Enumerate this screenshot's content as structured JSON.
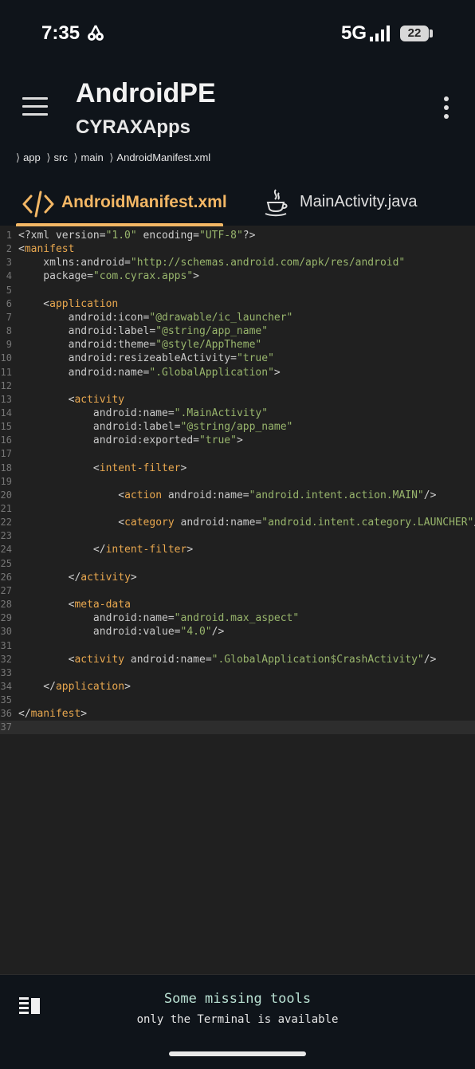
{
  "status_bar": {
    "time": "7:35",
    "network": "5G",
    "battery": "22",
    "icons": [
      "cherry-icon",
      "signal-icon",
      "battery-icon"
    ]
  },
  "toolbar": {
    "title": "AndroidPE",
    "subtitle": "CYRAXApps",
    "menu_icon": "hamburger-menu-icon",
    "more_icon": "more-vertical-icon"
  },
  "breadcrumb": [
    "app",
    "src",
    "main",
    "AndroidManifest.xml"
  ],
  "tabs": [
    {
      "label": "AndroidManifest.xml",
      "icon": "code-icon",
      "active": true
    },
    {
      "label": "MainActivity.java",
      "icon": "java-icon",
      "active": false
    }
  ],
  "editor": {
    "current_line": 37,
    "lines": [
      [
        [
          "pun",
          "<?xml version="
        ],
        [
          "str",
          "\"1.0\""
        ],
        [
          "pun",
          " encoding="
        ],
        [
          "str",
          "\"UTF-8\""
        ],
        [
          "pun",
          "?>"
        ]
      ],
      [
        [
          "pun",
          "<"
        ],
        [
          "tag",
          "manifest"
        ]
      ],
      [
        [
          "attr",
          "    xmlns:android="
        ],
        [
          "str",
          "\"http://schemas.android.com/apk/res/android\""
        ]
      ],
      [
        [
          "attr",
          "    package="
        ],
        [
          "str",
          "\"com.cyrax.apps\""
        ],
        [
          "pun",
          ">"
        ]
      ],
      [],
      [
        [
          "pun",
          "    <"
        ],
        [
          "tag",
          "application"
        ]
      ],
      [
        [
          "attr",
          "        android:icon="
        ],
        [
          "str",
          "\"@drawable/ic_launcher\""
        ]
      ],
      [
        [
          "attr",
          "        android:label="
        ],
        [
          "str",
          "\"@string/app_name\""
        ]
      ],
      [
        [
          "attr",
          "        android:theme="
        ],
        [
          "str",
          "\"@style/AppTheme\""
        ]
      ],
      [
        [
          "attr",
          "        android:resizeableActivity="
        ],
        [
          "str",
          "\"true\""
        ]
      ],
      [
        [
          "attr",
          "        android:name="
        ],
        [
          "str",
          "\".GlobalApplication\""
        ],
        [
          "pun",
          ">"
        ]
      ],
      [],
      [
        [
          "pun",
          "        <"
        ],
        [
          "tag",
          "activity"
        ]
      ],
      [
        [
          "attr",
          "            android:name="
        ],
        [
          "str",
          "\".MainActivity\""
        ]
      ],
      [
        [
          "attr",
          "            android:label="
        ],
        [
          "str",
          "\"@string/app_name\""
        ]
      ],
      [
        [
          "attr",
          "            android:exported="
        ],
        [
          "str",
          "\"true\""
        ],
        [
          "pun",
          ">"
        ]
      ],
      [],
      [
        [
          "pun",
          "            <"
        ],
        [
          "tag",
          "intent-filter"
        ],
        [
          "pun",
          ">"
        ]
      ],
      [],
      [
        [
          "pun",
          "                <"
        ],
        [
          "tag",
          "action"
        ],
        [
          "attr",
          " android:name="
        ],
        [
          "str",
          "\"android.intent.action.MAIN\""
        ],
        [
          "pun",
          "/>"
        ]
      ],
      [],
      [
        [
          "pun",
          "                <"
        ],
        [
          "tag",
          "category"
        ],
        [
          "attr",
          " android:name="
        ],
        [
          "str",
          "\"android.intent.category.LAUNCHER\""
        ],
        [
          "pun",
          "/>"
        ]
      ],
      [],
      [
        [
          "pun",
          "            </"
        ],
        [
          "tag",
          "intent-filter"
        ],
        [
          "pun",
          ">"
        ]
      ],
      [],
      [
        [
          "pun",
          "        </"
        ],
        [
          "tag",
          "activity"
        ],
        [
          "pun",
          ">"
        ]
      ],
      [],
      [
        [
          "pun",
          "        <"
        ],
        [
          "tag",
          "meta-data"
        ]
      ],
      [
        [
          "attr",
          "            android:name="
        ],
        [
          "str",
          "\"android.max_aspect\""
        ]
      ],
      [
        [
          "attr",
          "            android:value="
        ],
        [
          "str",
          "\"4.0\""
        ],
        [
          "pun",
          "/>"
        ]
      ],
      [],
      [
        [
          "pun",
          "        <"
        ],
        [
          "tag",
          "activity"
        ],
        [
          "attr",
          " android:name="
        ],
        [
          "str",
          "\".GlobalApplication$CrashActivity\""
        ],
        [
          "pun",
          "/>"
        ]
      ],
      [],
      [
        [
          "pun",
          "    </"
        ],
        [
          "tag",
          "application"
        ],
        [
          "pun",
          ">"
        ]
      ],
      [],
      [
        [
          "pun",
          "</"
        ],
        [
          "tag",
          "manifest"
        ],
        [
          "pun",
          ">"
        ]
      ],
      []
    ]
  },
  "bottom_panel": {
    "panel_icon": "panel-toggle-icon",
    "title": "Some missing tools",
    "subtitle": "only the Terminal is available"
  },
  "colors": {
    "accent": "#f3b765",
    "tag": "#e9a84f",
    "string": "#98b56c",
    "background": "#202020",
    "toolbar": "#0f141a"
  }
}
